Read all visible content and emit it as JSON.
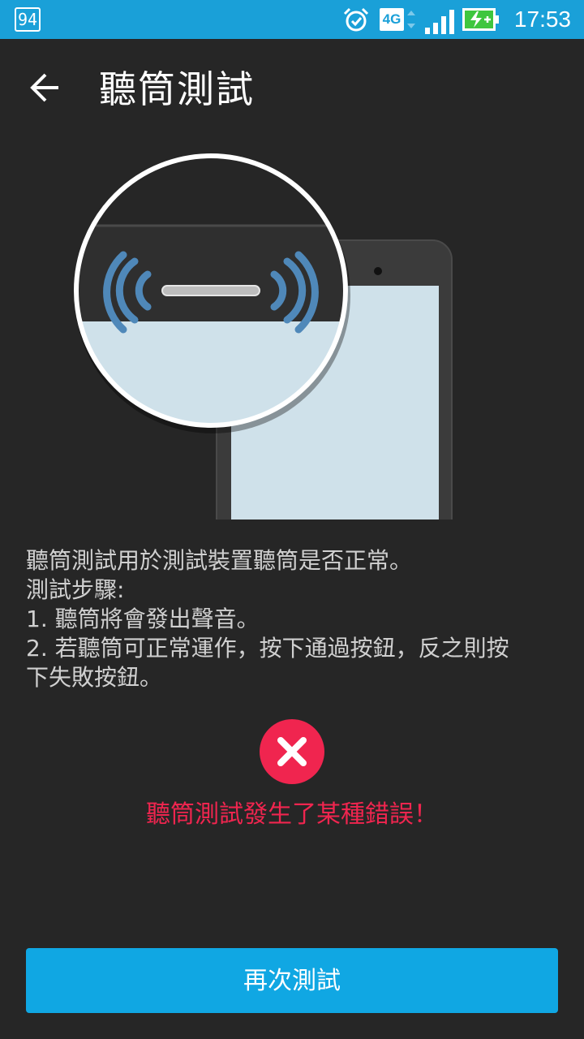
{
  "status_bar": {
    "notification_badge": "94",
    "alarm_icon": "alarm-icon",
    "network_type": "4G",
    "signal_icon": "signal-icon",
    "battery_icon": "battery-charging-icon",
    "time": "17:53"
  },
  "app_bar": {
    "back_icon": "arrow-back-icon",
    "title": "聽筒測試"
  },
  "illustration_icon": "phone-earpiece-illustration",
  "description": {
    "line1": "聽筒測試用於測試裝置聽筒是否正常。",
    "line2": "測試步驟:",
    "line3": "1. 聽筒將會發出聲音。",
    "line4": "2. 若聽筒可正常運作，按下通過按鈕，反之則按",
    "line5": "下失敗按鈕。"
  },
  "result": {
    "icon": "error-x-icon",
    "message": "聽筒測試發生了某種錯誤！"
  },
  "actions": {
    "retry_label": "再次測試"
  },
  "colors": {
    "status_bar": "#1aa0d8",
    "background": "#262626",
    "error": "#f0254f",
    "button": "#10a7e3",
    "sound_waves": "#4f88b9"
  }
}
